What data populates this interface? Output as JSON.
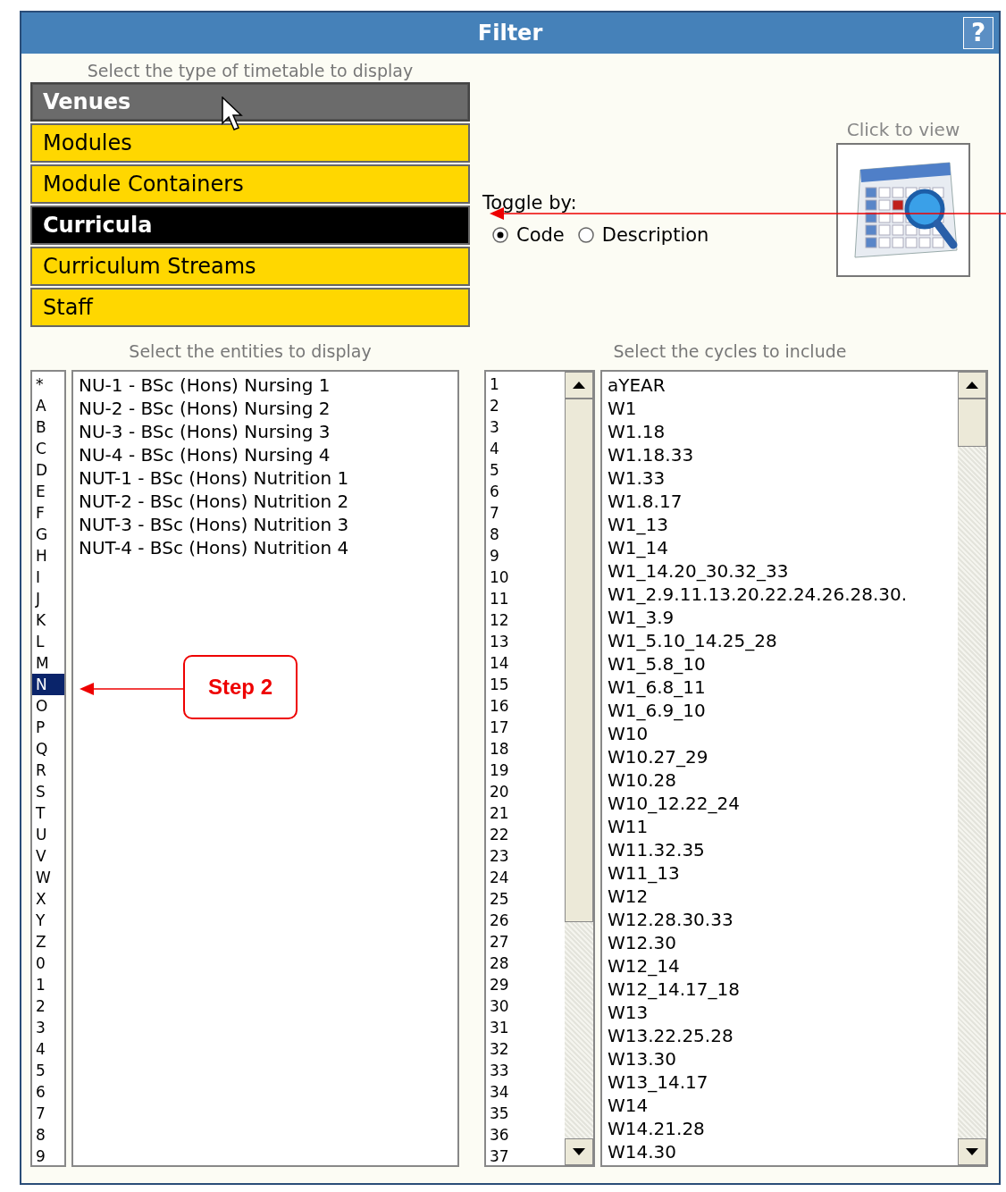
{
  "window": {
    "title": "Filter",
    "help": "?"
  },
  "type_prompt": "Select the type of timetable to display",
  "timetable_types": [
    {
      "label": "Venues",
      "selected": false,
      "hovered": true
    },
    {
      "label": "Modules",
      "selected": false,
      "hovered": false
    },
    {
      "label": "Module Containers",
      "selected": false,
      "hovered": false
    },
    {
      "label": "Curricula",
      "selected": true,
      "hovered": false
    },
    {
      "label": "Curriculum Streams",
      "selected": false,
      "hovered": false
    },
    {
      "label": "Staff",
      "selected": false,
      "hovered": false
    }
  ],
  "view": {
    "label": "Click to view"
  },
  "toggle": {
    "label": "Toggle by:",
    "options": [
      {
        "label": "Code",
        "selected": true
      },
      {
        "label": "Description",
        "selected": false
      }
    ]
  },
  "entities": {
    "label": "Select the entities to display",
    "letters": [
      {
        "label": "*",
        "selected": false
      },
      {
        "label": "A",
        "selected": false
      },
      {
        "label": "B",
        "selected": false
      },
      {
        "label": "C",
        "selected": false
      },
      {
        "label": "D",
        "selected": false
      },
      {
        "label": "E",
        "selected": false
      },
      {
        "label": "F",
        "selected": false
      },
      {
        "label": "G",
        "selected": false
      },
      {
        "label": "H",
        "selected": false
      },
      {
        "label": "I",
        "selected": false
      },
      {
        "label": "J",
        "selected": false
      },
      {
        "label": "K",
        "selected": false
      },
      {
        "label": "L",
        "selected": false
      },
      {
        "label": "M",
        "selected": false
      },
      {
        "label": "N",
        "selected": true
      },
      {
        "label": "O",
        "selected": false
      },
      {
        "label": "P",
        "selected": false
      },
      {
        "label": "Q",
        "selected": false
      },
      {
        "label": "R",
        "selected": false
      },
      {
        "label": "S",
        "selected": false
      },
      {
        "label": "T",
        "selected": false
      },
      {
        "label": "U",
        "selected": false
      },
      {
        "label": "V",
        "selected": false
      },
      {
        "label": "W",
        "selected": false
      },
      {
        "label": "X",
        "selected": false
      },
      {
        "label": "Y",
        "selected": false
      },
      {
        "label": "Z",
        "selected": false
      },
      {
        "label": "0",
        "selected": false
      },
      {
        "label": "1",
        "selected": false
      },
      {
        "label": "2",
        "selected": false
      },
      {
        "label": "3",
        "selected": false
      },
      {
        "label": "4",
        "selected": false
      },
      {
        "label": "5",
        "selected": false
      },
      {
        "label": "6",
        "selected": false
      },
      {
        "label": "7",
        "selected": false
      },
      {
        "label": "8",
        "selected": false
      },
      {
        "label": "9",
        "selected": false
      }
    ],
    "items": [
      "NU-1 - BSc (Hons) Nursing 1",
      "NU-2 - BSc (Hons) Nursing 2",
      "NU-3 - BSc (Hons) Nursing 3",
      "NU-4 - BSc (Hons) Nursing 4",
      "NUT-1 - BSc (Hons) Nutrition 1",
      "NUT-2 - BSc (Hons) Nutrition 2",
      "NUT-3 - BSc (Hons) Nutrition 3",
      "NUT-4 - BSc (Hons) Nutrition 4"
    ]
  },
  "cycles": {
    "label": "Select the cycles to include",
    "numbers": [
      "1",
      "2",
      "3",
      "4",
      "5",
      "6",
      "7",
      "8",
      "9",
      "10",
      "11",
      "12",
      "13",
      "14",
      "15",
      "16",
      "17",
      "18",
      "19",
      "20",
      "21",
      "22",
      "23",
      "24",
      "25",
      "26",
      "27",
      "28",
      "29",
      "30",
      "31",
      "32",
      "33",
      "34",
      "35",
      "36",
      "37"
    ],
    "items": [
      "aYEAR",
      "W1",
      "W1.18",
      "W1.18.33",
      "W1.33",
      "W1.8.17",
      "W1_13",
      "W1_14",
      "W1_14.20_30.32_33",
      "W1_2.9.11.13.20.22.24.26.28.30.",
      "W1_3.9",
      "W1_5.10_14.25_28",
      "W1_5.8_10",
      "W1_6.8_11",
      "W1_6.9_10",
      "W10",
      "W10.27_29",
      "W10.28",
      "W10_12.22_24",
      "W11",
      "W11.32.35",
      "W11_13",
      "W12",
      "W12.28.30.33",
      "W12.30",
      "W12_14",
      "W12_14.17_18",
      "W13",
      "W13.22.25.28",
      "W13.30",
      "W13_14.17",
      "W14",
      "W14.21.28",
      "W14.30"
    ]
  },
  "annotations": [
    {
      "kind": "arrow"
    },
    {
      "kind": "callout",
      "text": "Step 2"
    }
  ]
}
